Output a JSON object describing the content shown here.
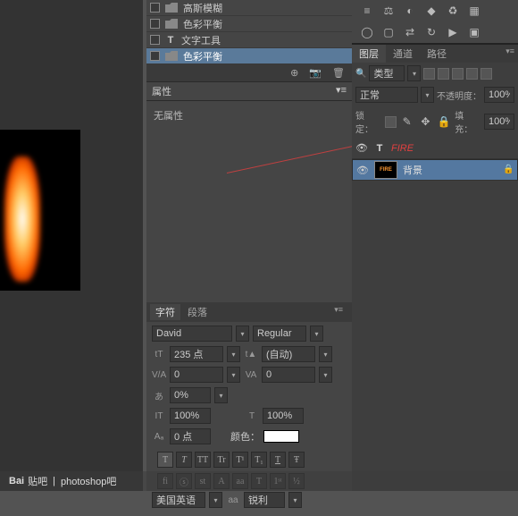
{
  "history": {
    "items": [
      {
        "label": "高斯模糊",
        "icon": "folder"
      },
      {
        "label": "色彩平衡",
        "icon": "folder"
      },
      {
        "label": "文字工具",
        "icon": "text"
      },
      {
        "label": "色彩平衡",
        "icon": "folder"
      }
    ]
  },
  "properties": {
    "tab": "属性",
    "body": "无属性"
  },
  "character": {
    "tabs": [
      "字符",
      "段落"
    ],
    "font": "David",
    "weight": "Regular",
    "size": "235 点",
    "leading": "(自动)",
    "va1": "0",
    "va2": "0",
    "scale": "0%",
    "height": "100%",
    "width": "100%",
    "baseline": "0 点",
    "color_label": "颜色：",
    "lang": "美国英语",
    "aa": "aa",
    "aa_mode": "锐利",
    "style_btns": [
      "T",
      "T",
      "TT",
      "Tr",
      "T¹",
      "T₁",
      "T",
      "Ŧ"
    ],
    "ot_btns": [
      "fi",
      "ⓢ",
      "st",
      "A",
      "aa",
      "T",
      "1ˢᵗ",
      "½"
    ]
  },
  "layers": {
    "tabs": [
      "图层",
      "通道",
      "路径"
    ],
    "kind": "类型",
    "blend": "正常",
    "opacity_label": "不透明度：",
    "opacity": "100%",
    "lock_label": "锁定：",
    "fill_label": "填充：",
    "fill": "100%",
    "items": [
      {
        "name": "FIRE",
        "type": "text",
        "red": true
      },
      {
        "name": "背景",
        "type": "image",
        "locked": true
      }
    ]
  },
  "footer": {
    "logo": "Bai",
    "logo2": "贴吧",
    "sep": "|",
    "text": "photoshop吧"
  }
}
